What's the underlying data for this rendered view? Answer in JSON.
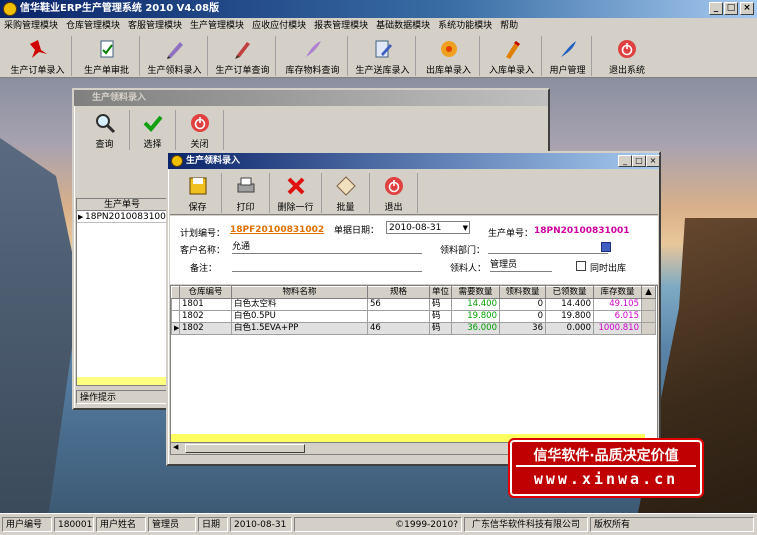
{
  "app": {
    "title": "信华鞋业ERP生产管理系统  2010 V4.08版",
    "window_min": "_",
    "window_max": "□",
    "window_close": "×"
  },
  "menu": [
    "采购管理模块",
    "仓库管理模块",
    "客服管理模块",
    "生产管理模块",
    "应收应付模块",
    "报表管理模块",
    "基础数据模块",
    "系统功能模块",
    "帮助"
  ],
  "toolbar": [
    "生产订单录入",
    "生产单审批",
    "生产领料录入",
    "生产订单查询",
    "库存物料查询",
    "生产送库录入",
    "出库单录入",
    "入库单录入",
    "用户管理",
    "退出系统"
  ],
  "back_window": {
    "title": "生产领料录入",
    "buttons": [
      "查询",
      "选择",
      "关闭"
    ],
    "col_header": "生产单号",
    "row_value": "18PN20100831001",
    "ops_label": "操作提示"
  },
  "front_window": {
    "title": "生产领料录入",
    "buttons": [
      "保存",
      "打印",
      "删除一行",
      "批量",
      "退出"
    ],
    "fields": {
      "plan_no_label": "计划编号：",
      "plan_no": "18PF20100831002",
      "date_label": "单据日期：",
      "date": "2010-08-31",
      "prod_no_label": "生产单号：",
      "prod_no": "18PN20100831001",
      "customer_label": "客户名称：",
      "customer": "允通",
      "dept_label": "领料部门：",
      "dept": "",
      "remark_label": "备注：",
      "remark": "",
      "picker_label": "领料人：",
      "picker": "管理员",
      "same_time_label": "同时出库"
    },
    "columns": [
      "仓库编号",
      "物料名称",
      "规格",
      "单位",
      "需要数量",
      "领料数量",
      "已领数量",
      "库存数量"
    ],
    "rows": [
      {
        "wh": "1801",
        "name": "白色太空料",
        "spec": "56",
        "unit": "码",
        "need": "14.400",
        "pick": "0",
        "picked": "14.400",
        "stock": "49.105"
      },
      {
        "wh": "1802",
        "name": "白色0.5PU",
        "spec": "",
        "unit": "码",
        "need": "19.800",
        "pick": "0",
        "picked": "19.800",
        "stock": "6.015"
      },
      {
        "wh": "1802",
        "name": "白色1.5EVA+PP",
        "spec": "46",
        "unit": "码",
        "need": "36.000",
        "pick": "36",
        "picked": "0.000",
        "stock": "1000.810"
      }
    ]
  },
  "stamp": {
    "line1": "信华软件·品质决定价值",
    "line2": "www.xinwa.cn"
  },
  "status": {
    "user_no_label": "用户编号",
    "user_no": "180001",
    "user_name_label": "用户姓名",
    "user_name": "管理员",
    "date_label": "日期",
    "date": "2010-08-31",
    "copyright": "©1999-2010?",
    "company": "广东信华软件科技有限公司",
    "rights": "版权所有"
  },
  "colors": {
    "titlebar": "#0a246a",
    "need_qty": "#00a000",
    "stock_qty": "#d000d0",
    "plan_no": "#e07000",
    "prod_no": "#d000a0"
  }
}
